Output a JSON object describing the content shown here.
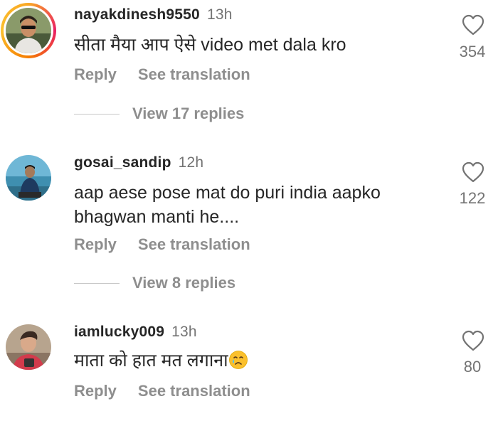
{
  "comments": [
    {
      "username": "nayakdinesh9550",
      "time": "13h",
      "text": "सीता मैया आप ऐसे video met dala kro",
      "likes": "354",
      "reply": "Reply",
      "translate": "See translation",
      "view_replies": "View 17 replies",
      "has_story": true
    },
    {
      "username": "gosai_sandip",
      "time": "12h",
      "text": "aap aese pose mat do puri india aapko bhagwan manti he....",
      "likes": "122",
      "reply": "Reply",
      "translate": "See translation",
      "view_replies": "View 8 replies",
      "has_story": false
    },
    {
      "username": "iamlucky009",
      "time": "13h",
      "text": "माता को हात मत लगाना",
      "emoji": "crying-face-emoji",
      "likes": "80",
      "reply": "Reply",
      "translate": "See translation",
      "has_story": false
    }
  ],
  "colors": {
    "text": "#262626",
    "secondary": "#737373",
    "action": "#8e8e8e",
    "divider": "#c7c7c7"
  }
}
